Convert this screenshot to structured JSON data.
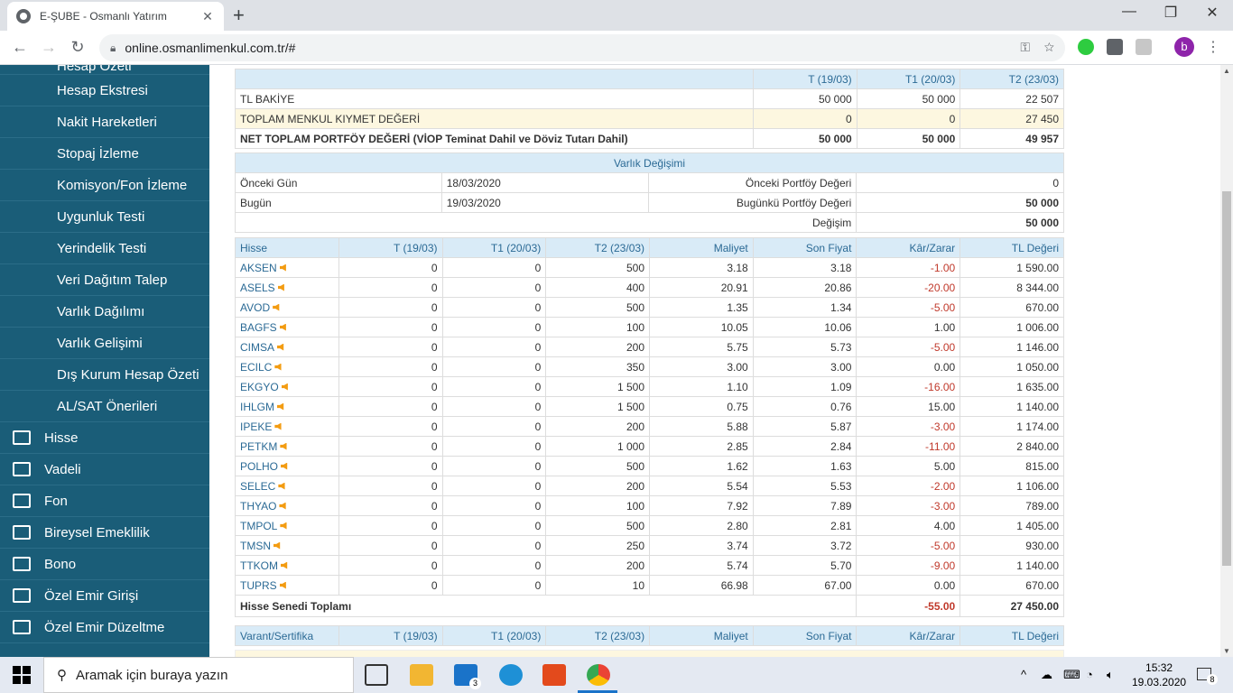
{
  "browser": {
    "tab_title": "E-ŞUBE - Osmanlı Yatırım",
    "url": "online.osmanlimenkul.com.tr/#"
  },
  "sidebar": {
    "sub_items": [
      "Hesap Özeti",
      "Hesap Ekstresi",
      "Nakit Hareketleri",
      "Stopaj İzleme",
      "Komisyon/Fon İzleme",
      "Uygunluk Testi",
      "Yerindelik Testi",
      "Veri Dağıtım Talep",
      "Varlık Dağılımı",
      "Varlık Gelişimi",
      "Dış Kurum Hesap Özeti",
      "AL/SAT Önerileri"
    ],
    "main_items": [
      "Hisse",
      "Vadeli",
      "Fon",
      "Bireysel Emeklilik",
      "Bono",
      "Özel Emir Girişi",
      "Özel Emir Düzeltme"
    ]
  },
  "summary": {
    "headers": [
      "",
      "T (19/03)",
      "T1 (20/03)",
      "T2 (23/03)"
    ],
    "rows": [
      [
        "TL BAKİYE",
        "50 000",
        "50 000",
        "22 507"
      ],
      [
        "TOPLAM MENKUL KIYMET DEĞERİ",
        "0",
        "0",
        "27 450"
      ],
      [
        "NET TOPLAM PORTFÖY DEĞERİ (VİOP Teminat Dahil ve Döviz Tutarı Dahil)",
        "50 000",
        "50 000",
        "49 957"
      ]
    ]
  },
  "change": {
    "title": "Varlık Değişimi",
    "prev_day_label": "Önceki Gün",
    "prev_day": "18/03/2020",
    "prev_value_label": "Önceki Portföy Değeri",
    "prev_value": "0",
    "today_label": "Bugün",
    "today": "19/03/2020",
    "today_value_label": "Bugünkü Portföy Değeri",
    "today_value": "50 000",
    "diff_label": "Değişim",
    "diff": "50 000"
  },
  "stocks": {
    "headers": [
      "Hisse",
      "T (19/03)",
      "T1 (20/03)",
      "T2 (23/03)",
      "Maliyet",
      "Son Fiyat",
      "Kâr/Zarar",
      "TL Değeri"
    ],
    "rows": [
      [
        "AKSEN",
        "0",
        "0",
        "500",
        "3.18",
        "3.18",
        "-1.00",
        "1 590.00"
      ],
      [
        "ASELS",
        "0",
        "0",
        "400",
        "20.91",
        "20.86",
        "-20.00",
        "8 344.00"
      ],
      [
        "AVOD",
        "0",
        "0",
        "500",
        "1.35",
        "1.34",
        "-5.00",
        "670.00"
      ],
      [
        "BAGFS",
        "0",
        "0",
        "100",
        "10.05",
        "10.06",
        "1.00",
        "1 006.00"
      ],
      [
        "CIMSA",
        "0",
        "0",
        "200",
        "5.75",
        "5.73",
        "-5.00",
        "1 146.00"
      ],
      [
        "ECILC",
        "0",
        "0",
        "350",
        "3.00",
        "3.00",
        "0.00",
        "1 050.00"
      ],
      [
        "EKGYO",
        "0",
        "0",
        "1 500",
        "1.10",
        "1.09",
        "-16.00",
        "1 635.00"
      ],
      [
        "IHLGM",
        "0",
        "0",
        "1 500",
        "0.75",
        "0.76",
        "15.00",
        "1 140.00"
      ],
      [
        "IPEKE",
        "0",
        "0",
        "200",
        "5.88",
        "5.87",
        "-3.00",
        "1 174.00"
      ],
      [
        "PETKM",
        "0",
        "0",
        "1 000",
        "2.85",
        "2.84",
        "-11.00",
        "2 840.00"
      ],
      [
        "POLHO",
        "0",
        "0",
        "500",
        "1.62",
        "1.63",
        "5.00",
        "815.00"
      ],
      [
        "SELEC",
        "0",
        "0",
        "200",
        "5.54",
        "5.53",
        "-2.00",
        "1 106.00"
      ],
      [
        "THYAO",
        "0",
        "0",
        "100",
        "7.92",
        "7.89",
        "-3.00",
        "789.00"
      ],
      [
        "TMPOL",
        "0",
        "0",
        "500",
        "2.80",
        "2.81",
        "4.00",
        "1 405.00"
      ],
      [
        "TMSN",
        "0",
        "0",
        "250",
        "3.74",
        "3.72",
        "-5.00",
        "930.00"
      ],
      [
        "TTKOM",
        "0",
        "0",
        "200",
        "5.74",
        "5.70",
        "-9.00",
        "1 140.00"
      ],
      [
        "TUPRS",
        "0",
        "0",
        "10",
        "66.98",
        "67.00",
        "0.00",
        "670.00"
      ]
    ],
    "total_label": "Hisse Senedi Toplamı",
    "total_pl": "-55.00",
    "total_value": "27 450.00"
  },
  "warrants": {
    "headers": [
      "Varant/Sertifika",
      "T (19/03)",
      "T1 (20/03)",
      "T2 (23/03)",
      "Maliyet",
      "Son Fiyat",
      "Kâr/Zarar",
      "TL Değeri"
    ]
  },
  "taskbar": {
    "search_placeholder": "Aramak için buraya yazın",
    "time": "15:32",
    "date": "19.03.2020",
    "mail_badge": "3",
    "notif_badge": "8"
  }
}
